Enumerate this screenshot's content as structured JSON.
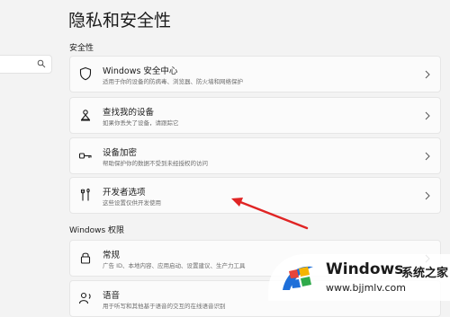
{
  "page_title": "隐私和安全性",
  "sections": {
    "security": "安全性",
    "windows_permissions": "Windows 权限"
  },
  "cards": [
    {
      "title": "Windows 安全中心",
      "desc": "适用于你的设备的防病毒、浏览器、防火墙和网络保护",
      "icon": "shield-icon"
    },
    {
      "title": "查找我的设备",
      "desc": "如果你丢失了设备，请跟踪它",
      "icon": "find-device-icon"
    },
    {
      "title": "设备加密",
      "desc": "帮助保护你的数据不受到未经授权的访问",
      "icon": "key-icon"
    },
    {
      "title": "开发者选项",
      "desc": "这些设置仅供开发使用",
      "icon": "developer-tools-icon"
    },
    {
      "title": "常规",
      "desc": "广告 ID、本地内容、应用启动、设置建议、生产力工具",
      "icon": "lock-icon"
    },
    {
      "title": "语音",
      "desc": "用于听写和其他基于语音的交互的在线语音识别",
      "icon": "speech-icon"
    }
  ],
  "annotation": {
    "color": "#e02424"
  },
  "watermark": {
    "brand": "Windows",
    "brand_cn": "系统之家",
    "url": "www.bjjmlv.com"
  },
  "colors": {
    "background": "#f3f3f3",
    "card": "#fbfbfb",
    "logo_blue": "#1e6fd9",
    "logo_red": "#e8443a",
    "logo_yellow": "#f5b400",
    "logo_green": "#2faa4b"
  }
}
